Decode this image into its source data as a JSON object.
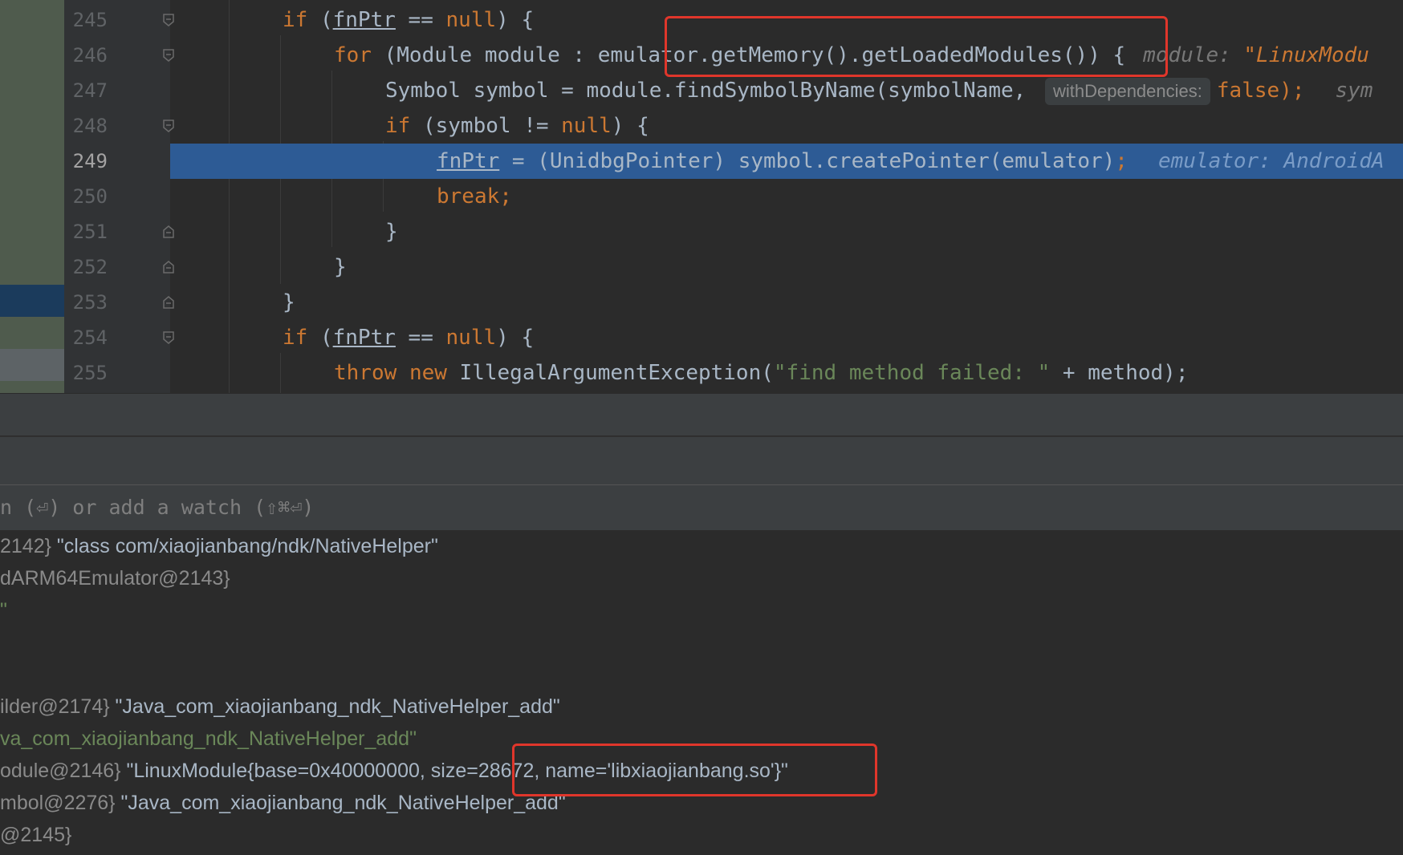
{
  "editor": {
    "line_numbers": [
      "245",
      "246",
      "247",
      "248",
      "249",
      "250",
      "251",
      "252",
      "253",
      "254",
      "255"
    ],
    "current_line": "249",
    "lines": {
      "l245": {
        "kw_if": "if",
        "p1": " (",
        "var": "fnPtr",
        "p2": " == ",
        "null": "null",
        "p3": ") {"
      },
      "l246": {
        "kw_for": "for",
        "code": " (Module module : emulator.getMemory().getLoadedModules()) {",
        "hint_label": "module: ",
        "hint_value": "\"LinuxModu"
      },
      "l247": {
        "code": "Symbol symbol = module.findSymbolByName(symbolName, ",
        "param_hint": "withDependencies:",
        "kw_false": "false",
        "tail": ");",
        "hint_tail": "sym"
      },
      "l248": {
        "kw_if": "if",
        "code": " (symbol != ",
        "null": "null",
        "tail": ") {"
      },
      "l249": {
        "var": "fnPtr",
        "code": " = (UnidbgPointer) symbol.createPointer(emulator)",
        "semi": ";",
        "hint": "emulator: AndroidA"
      },
      "l250": {
        "kw_break": "break;"
      },
      "l251": {
        "brace": "}"
      },
      "l252": {
        "brace": "}"
      },
      "l253": {
        "brace": "}"
      },
      "l254": {
        "kw_if": "if",
        "p1": " (",
        "var": "fnPtr",
        "p2": " == ",
        "null": "null",
        "p3": ") {"
      },
      "l255": {
        "kw_throw": "throw",
        "kw_new": "new",
        "code_a": " IllegalArgumentException(",
        "str": "\"find method failed: \"",
        "code_b": " + method);"
      }
    }
  },
  "watch": {
    "placeholder": "n (⏎) or add a watch (⇧⌘⏎)"
  },
  "variables": [
    {
      "ref": "2142}",
      "value": " \"class com/xiaojianbang/ndk/NativeHelper\""
    },
    {
      "ref": "dARM64Emulator@2143}",
      "value": ""
    },
    {
      "ref": "",
      "value": "\"",
      "green": true
    },
    {
      "ref": "ilder@2174}",
      "value": " \"Java_com_xiaojianbang_ndk_NativeHelper_add\""
    },
    {
      "ref": "",
      "value": "va_com_xiaojianbang_ndk_NativeHelper_add\"",
      "green": true
    },
    {
      "ref": "odule@2146}",
      "value": " \"LinuxModule{base=0x40000000, size=28672, name='libxiaojianbang.so'}\""
    },
    {
      "ref": "mbol@2276}",
      "value": " \"Java_com_xiaojianbang_ndk_NativeHelper_add\""
    },
    {
      "ref": "@2145}",
      "value": ""
    }
  ],
  "colors": {
    "highlight_box": "#e0362b",
    "execution_line": "#2d5b95",
    "keyword": "#cc7832",
    "string": "#6a8759"
  }
}
